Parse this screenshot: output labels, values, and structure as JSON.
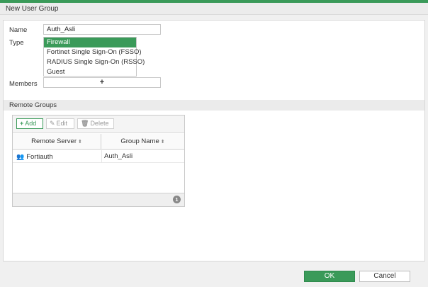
{
  "window": {
    "title": "New User Group"
  },
  "form": {
    "name_label": "Name",
    "name_value": "Auth_Asli",
    "type_label": "Type",
    "type_options": [
      {
        "label": "Firewall",
        "selected": true
      },
      {
        "label": "Fortinet Single Sign-On (FSSO)",
        "selected": false
      },
      {
        "label": "RADIUS Single Sign-On (RSSO)",
        "selected": false
      },
      {
        "label": "Guest",
        "selected": false
      }
    ],
    "members_label": "Members",
    "members_add_symbol": "+"
  },
  "remote_groups": {
    "section_title": "Remote Groups",
    "toolbar": {
      "add_label": "Add",
      "add_icon": "plus-icon",
      "edit_label": "Edit",
      "edit_icon": "pencil-icon",
      "delete_label": "Delete",
      "delete_icon": "trash-icon"
    },
    "columns": [
      "Remote Server",
      "Group Name"
    ],
    "rows": [
      {
        "remote_server": "Fortiauth",
        "remote_server_icon": "users-icon",
        "group_name": "Auth_Asli"
      }
    ],
    "count": "1"
  },
  "actions": {
    "ok_label": "OK",
    "cancel_label": "Cancel"
  },
  "colors": {
    "accent": "#3a9a59"
  }
}
